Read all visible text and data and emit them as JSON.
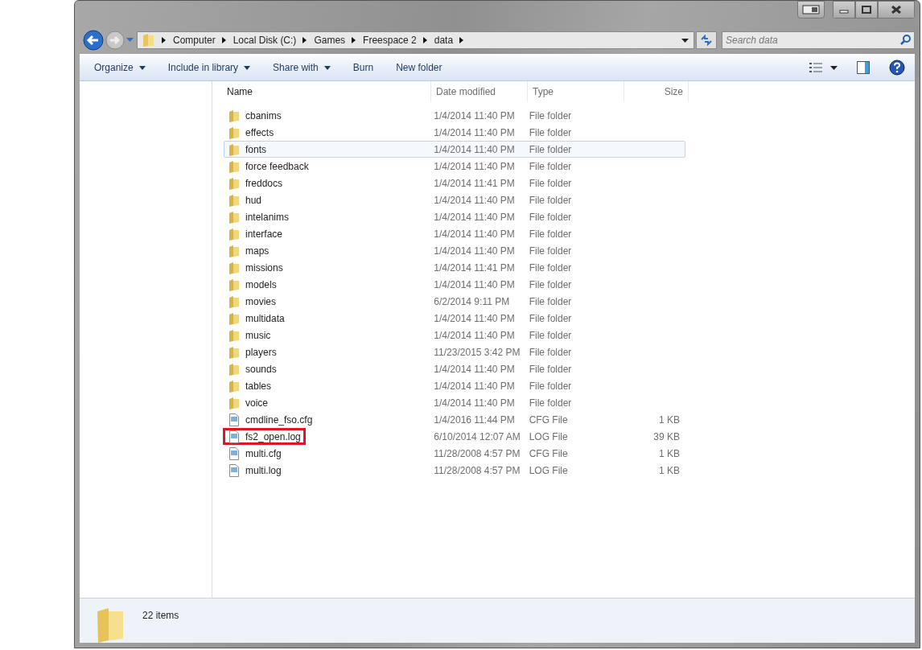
{
  "address_bar": {
    "crumbs": [
      "Computer",
      "Local Disk (C:)",
      "Games",
      "Freespace 2",
      "data"
    ]
  },
  "search": {
    "placeholder": "Search data"
  },
  "toolbar": {
    "buttons": [
      {
        "label": "Organize",
        "dropdown": true
      },
      {
        "label": "Include in library",
        "dropdown": true
      },
      {
        "label": "Share with",
        "dropdown": true
      },
      {
        "label": "Burn",
        "dropdown": false
      },
      {
        "label": "New folder",
        "dropdown": false
      }
    ]
  },
  "table": {
    "columns": [
      "Name",
      "Date modified",
      "Type",
      "Size"
    ],
    "rows": [
      {
        "kind": "folder",
        "name": "cbanims",
        "date": "1/4/2014 11:40 PM",
        "type": "File folder",
        "selected": false,
        "marked": false
      },
      {
        "kind": "folder",
        "name": "effects",
        "date": "1/4/2014 11:40 PM",
        "type": "File folder",
        "selected": false,
        "marked": false
      },
      {
        "kind": "folder",
        "name": "fonts",
        "date": "1/4/2014 11:40 PM",
        "type": "File folder",
        "selected": true,
        "marked": false
      },
      {
        "kind": "folder",
        "name": "force feedback",
        "date": "1/4/2014 11:40 PM",
        "type": "File folder",
        "selected": false,
        "marked": false
      },
      {
        "kind": "folder",
        "name": "freddocs",
        "date": "1/4/2014 11:41 PM",
        "type": "File folder",
        "selected": false,
        "marked": false
      },
      {
        "kind": "folder",
        "name": "hud",
        "date": "1/4/2014 11:40 PM",
        "type": "File folder",
        "selected": false,
        "marked": false
      },
      {
        "kind": "folder",
        "name": "intelanims",
        "date": "1/4/2014 11:40 PM",
        "type": "File folder",
        "selected": false,
        "marked": false
      },
      {
        "kind": "folder",
        "name": "interface",
        "date": "1/4/2014 11:40 PM",
        "type": "File folder",
        "selected": false,
        "marked": false
      },
      {
        "kind": "folder",
        "name": "maps",
        "date": "1/4/2014 11:40 PM",
        "type": "File folder",
        "selected": false,
        "marked": false
      },
      {
        "kind": "folder",
        "name": "missions",
        "date": "1/4/2014 11:41 PM",
        "type": "File folder",
        "selected": false,
        "marked": false
      },
      {
        "kind": "folder",
        "name": "models",
        "date": "1/4/2014 11:40 PM",
        "type": "File folder",
        "selected": false,
        "marked": false
      },
      {
        "kind": "folder",
        "name": "movies",
        "date": "6/2/2014 9:11 PM",
        "type": "File folder",
        "selected": false,
        "marked": false
      },
      {
        "kind": "folder",
        "name": "multidata",
        "date": "1/4/2014 11:40 PM",
        "type": "File folder",
        "selected": false,
        "marked": false
      },
      {
        "kind": "folder",
        "name": "music",
        "date": "1/4/2014 11:40 PM",
        "type": "File folder",
        "selected": false,
        "marked": false
      },
      {
        "kind": "folder",
        "name": "players",
        "date": "11/23/2015 3:42 PM",
        "type": "File folder",
        "selected": false,
        "marked": false
      },
      {
        "kind": "folder",
        "name": "sounds",
        "date": "1/4/2014 11:40 PM",
        "type": "File folder",
        "selected": false,
        "marked": false
      },
      {
        "kind": "folder",
        "name": "tables",
        "date": "1/4/2014 11:40 PM",
        "type": "File folder",
        "selected": false,
        "marked": false
      },
      {
        "kind": "folder",
        "name": "voice",
        "date": "1/4/2014 11:40 PM",
        "type": "File folder",
        "selected": false,
        "marked": false
      },
      {
        "kind": "file",
        "name": "cmdline_fso.cfg",
        "date": "1/4/2016 11:44 PM",
        "type": "CFG File",
        "size": "1 KB",
        "selected": false,
        "marked": false
      },
      {
        "kind": "file",
        "name": "fs2_open.log",
        "date": "6/10/2014 12:07 AM",
        "type": "LOG File",
        "size": "39 KB",
        "selected": false,
        "marked": true
      },
      {
        "kind": "file",
        "name": "multi.cfg",
        "date": "11/28/2008 4:57 PM",
        "type": "CFG File",
        "size": "1 KB",
        "selected": false,
        "marked": false
      },
      {
        "kind": "file",
        "name": "multi.log",
        "date": "11/28/2008 4:57 PM",
        "type": "LOG File",
        "size": "1 KB",
        "selected": false,
        "marked": false
      }
    ]
  },
  "status_bar": {
    "item_count": "22 items"
  }
}
